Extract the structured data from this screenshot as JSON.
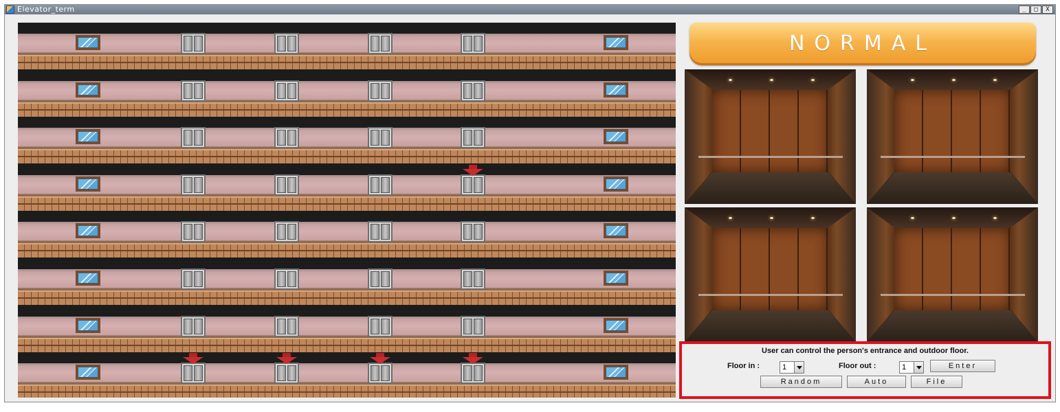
{
  "window": {
    "title": "Elevator_term",
    "controls": {
      "minimize": "_",
      "maximize": "□",
      "close": "X"
    }
  },
  "status": {
    "mode": "NORMAL",
    "color": "#f6b34a"
  },
  "building": {
    "floors": 8,
    "elevator_shafts": 4,
    "call_indicators": [
      {
        "floor_row": 4,
        "shaft": 4,
        "direction": "down"
      },
      {
        "floor_row": 8,
        "shaft": 1,
        "direction": "down"
      },
      {
        "floor_row": 8,
        "shaft": 2,
        "direction": "down"
      },
      {
        "floor_row": 8,
        "shaft": 3,
        "direction": "down"
      },
      {
        "floor_row": 8,
        "shaft": 4,
        "direction": "down"
      }
    ]
  },
  "cabins": [
    "elevator-1",
    "elevator-2",
    "elevator-3",
    "elevator-4"
  ],
  "controls": {
    "message": "User can control the person's entrance and outdoor floor.",
    "floor_in_label": "Floor in :",
    "floor_in_value": "1",
    "floor_out_label": "Floor out :",
    "floor_out_value": "1",
    "enter_label": "Enter",
    "random_label": "Random",
    "auto_label": "Auto",
    "file_label": "File",
    "highlight_color": "#e0121e"
  }
}
